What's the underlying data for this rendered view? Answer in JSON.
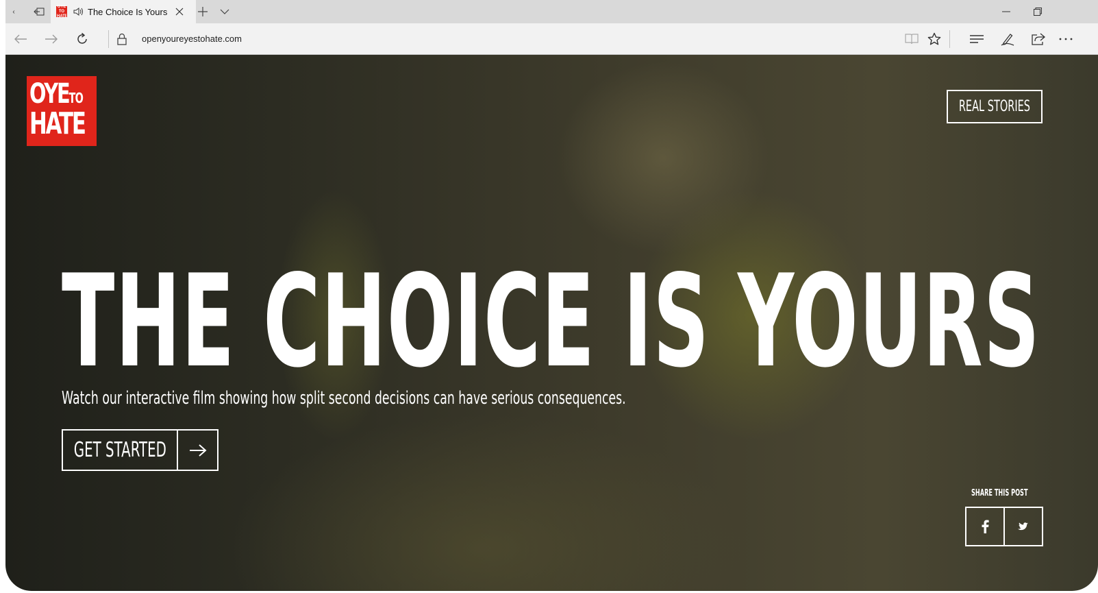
{
  "browser": {
    "tab": {
      "title": "The Choice Is Yours",
      "favicon_text": "OYE TO HATE",
      "audio_icon": "speaker-icon"
    },
    "address_bar": {
      "url": "openyoureyestohate.com"
    },
    "toolbar_icons": [
      "back-icon",
      "forward-icon",
      "refresh-icon",
      "lock-icon",
      "reading-view-icon",
      "favorite-star-icon",
      "hub-icon",
      "web-note-icon",
      "share-icon",
      "more-icon"
    ],
    "window_controls": [
      "minimize-icon",
      "restore-icon"
    ]
  },
  "page": {
    "logo": {
      "line1": "OYE",
      "line1_small": "TO",
      "line2": "HATE",
      "color": "#e0251b"
    },
    "nav": {
      "real_stories": "REAL STORIES"
    },
    "hero": {
      "headline": "THE CHOICE IS YOURS",
      "subtitle": "Watch our interactive film showing how split second decisions can have serious consequences.",
      "cta_label": "GET STARTED"
    },
    "share": {
      "label": "SHARE THIS POST",
      "facebook_icon": "facebook-icon",
      "twitter_icon": "twitter-icon"
    }
  }
}
